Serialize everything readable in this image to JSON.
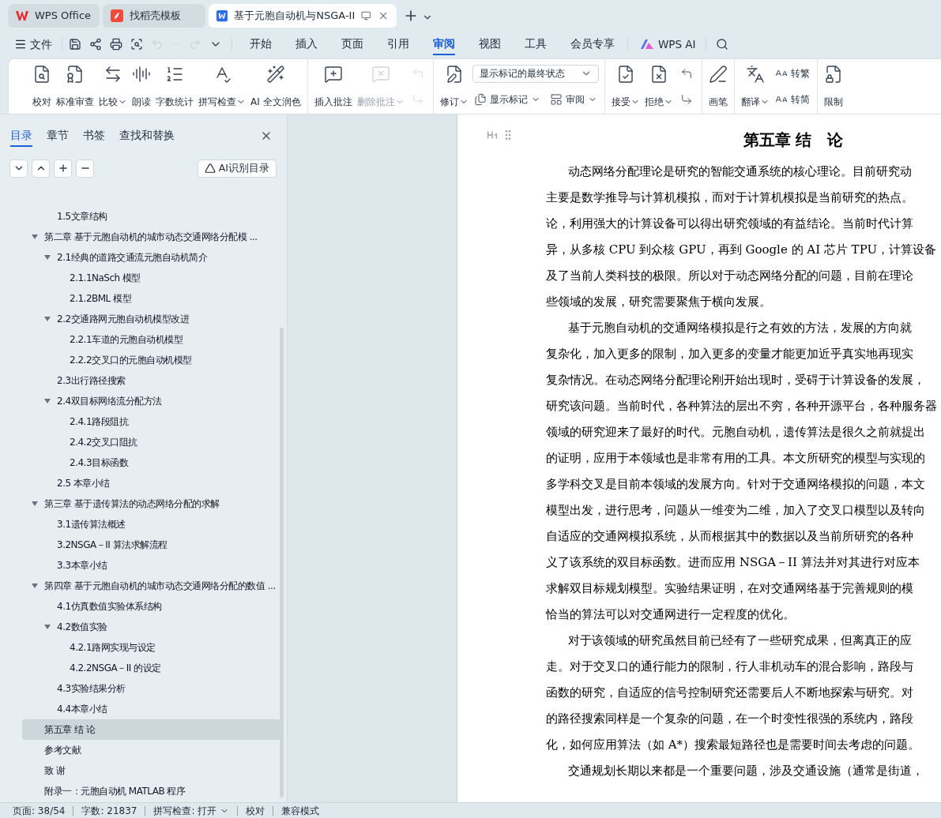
{
  "app_tabs": [
    {
      "kind": "home",
      "label": "WPS Office",
      "selected": false
    },
    {
      "kind": "template",
      "label": "找稻壳模板",
      "selected": false
    },
    {
      "kind": "document",
      "label": "基于元胞自动机与NSGA-II",
      "selected": true
    }
  ],
  "quick_toolbar": {
    "file_label": "文件",
    "undo_enabled": false,
    "redo_enabled": false
  },
  "menu_tabs": [
    {
      "label": "开始",
      "selected": false
    },
    {
      "label": "插入",
      "selected": false
    },
    {
      "label": "页面",
      "selected": false
    },
    {
      "label": "引用",
      "selected": false
    },
    {
      "label": "审阅",
      "selected": true
    },
    {
      "label": "视图",
      "selected": false
    },
    {
      "label": "工具",
      "selected": false
    },
    {
      "label": "会员专享",
      "selected": false
    }
  ],
  "wps_ai_label": "WPS AI",
  "ribbon": [
    {
      "items": [
        {
          "kind": "large",
          "label": "校对",
          "dropdown": false,
          "disabled": false
        },
        {
          "kind": "large",
          "label": "标准审查",
          "dropdown": false,
          "disabled": false
        },
        {
          "kind": "large",
          "label": "比较",
          "dropdown": true,
          "disabled": false
        },
        {
          "kind": "large",
          "label": "朗读",
          "dropdown": false,
          "disabled": false
        },
        {
          "kind": "large",
          "label": "字数统计",
          "dropdown": false,
          "disabled": false
        },
        {
          "kind": "large",
          "label": "拼写检查",
          "dropdown": true,
          "disabled": false
        },
        {
          "kind": "large",
          "label": "AI 全文润色",
          "dropdown": false,
          "disabled": false
        }
      ]
    },
    {
      "items": [
        {
          "kind": "large",
          "label": "插入批注",
          "dropdown": false,
          "disabled": false
        },
        {
          "kind": "large",
          "label": "删除批注",
          "dropdown": true,
          "disabled": true
        },
        {
          "kind": "stack",
          "rows": [
            [
              {
                "kind": "icon",
                "disabled": true
              }
            ],
            [
              {
                "kind": "icon",
                "disabled": true
              }
            ]
          ]
        }
      ]
    },
    {
      "items": [
        {
          "kind": "large",
          "label": "修订",
          "dropdown": true,
          "disabled": false
        },
        {
          "kind": "stack",
          "rows": [
            [
              {
                "kind": "select",
                "value": "显示标记的最终状态"
              }
            ],
            [
              {
                "kind": "small",
                "label": "显示标记",
                "dropdown": true,
                "disabled": false
              },
              {
                "kind": "small",
                "label": "审阅",
                "dropdown": true,
                "disabled": false
              }
            ]
          ]
        }
      ]
    },
    {
      "items": [
        {
          "kind": "large",
          "label": "接受",
          "dropdown": true,
          "disabled": false
        },
        {
          "kind": "large",
          "label": "拒绝",
          "dropdown": true,
          "disabled": false
        },
        {
          "kind": "stack",
          "rows": [
            [
              {
                "kind": "icon",
                "disabled": false
              }
            ],
            [
              {
                "kind": "icon",
                "disabled": false
              }
            ]
          ]
        }
      ]
    },
    {
      "items": [
        {
          "kind": "large",
          "label": "画笔",
          "dropdown": false,
          "disabled": false
        }
      ]
    },
    {
      "items": [
        {
          "kind": "large",
          "label": "翻译",
          "dropdown": true,
          "disabled": false
        },
        {
          "kind": "stack",
          "rows": [
            [
              {
                "kind": "small",
                "label": "转繁",
                "dropdown": false,
                "disabled": false
              }
            ],
            [
              {
                "kind": "small",
                "label": "转简",
                "dropdown": false,
                "disabled": false
              }
            ]
          ]
        }
      ]
    },
    {
      "items": [
        {
          "kind": "large",
          "label": "限制",
          "dropdown": false,
          "disabled": false
        }
      ]
    }
  ],
  "nav_panel": {
    "tabs": [
      {
        "label": "目录",
        "selected": true
      },
      {
        "label": "章节",
        "selected": false
      },
      {
        "label": "书签",
        "selected": false
      },
      {
        "label": "查找和替换",
        "selected": false
      }
    ],
    "ai_button": "AI识别目录",
    "toc": [
      {
        "children": [
          {
            "label": "1.5文章结构",
            "selected": false
          }
        ]
      },
      {
        "label": "第二章 基于元胞自动机的城市动态交通网络分配模 ...",
        "selected": false,
        "expanded": true,
        "children": [
          {
            "label": "2.1经典的道路交通流元胞自动机简介",
            "selected": false,
            "expanded": true,
            "children": [
              {
                "label": "2.1.1NaSch 模型",
                "selected": false
              },
              {
                "label": "2.1.2BML 模型",
                "selected": false
              }
            ]
          },
          {
            "label": "2.2交通路网元胞自动机模型改进",
            "selected": false,
            "expanded": true,
            "children": [
              {
                "label": "2.2.1车道的元胞自动机模型",
                "selected": false
              },
              {
                "label": "2.2.2交叉口的元胞自动机模型",
                "selected": false
              }
            ]
          },
          {
            "label": "2.3出行路径搜索",
            "selected": false
          },
          {
            "label": "2.4双目标网络流分配方法",
            "selected": false,
            "expanded": true,
            "children": [
              {
                "label": "2.4.1路段阻抗",
                "selected": false
              },
              {
                "label": "2.4.2交叉口阻抗",
                "selected": false
              },
              {
                "label": "2.4.3目标函数",
                "selected": false
              }
            ]
          },
          {
            "label": "2.5 本章小结",
            "selected": false
          }
        ]
      },
      {
        "label": "第三章 基于遗传算法的动态网络分配的求解",
        "selected": false,
        "expanded": true,
        "children": [
          {
            "label": "3.1遗传算法概述",
            "selected": false
          },
          {
            "label": "3.2NSGA－II 算法求解流程",
            "selected": false
          },
          {
            "label": "3.3本章小结",
            "selected": false
          }
        ]
      },
      {
        "label": "第四章 基于元胞自动机的城市动态交通网络分配的数值 ...",
        "selected": false,
        "expanded": true,
        "children": [
          {
            "label": "4.1仿真数值实验体系结构",
            "selected": false
          },
          {
            "label": "4.2数值实验",
            "selected": false,
            "expanded": true,
            "children": [
              {
                "label": "4.2.1路网实现与设定",
                "selected": false
              },
              {
                "label": "4.2.2NSGA－II 的设定",
                "selected": false
              }
            ]
          },
          {
            "label": "4.3实验结果分析",
            "selected": false
          },
          {
            "label": "4.4本章小结",
            "selected": false
          }
        ]
      },
      {
        "label": "第五章 结 论",
        "selected": true
      },
      {
        "label": "参考文献",
        "selected": false
      },
      {
        "label": "致 谢",
        "selected": false
      },
      {
        "label": "附录一：元胞自动机 MATLAB 程序",
        "selected": false
      }
    ]
  },
  "document": {
    "title": "第五章 结　论",
    "paragraphs": [
      [
        "动态网络分配理论是研究的智能交通系统的核心理论。目前研究动",
        "主要是数学推导与计算机模拟，而对于计算机模拟是当前研究的热点。",
        "论，利用强大的计算设备可以得出研究领域的有益结论。当前时代计算",
        "异，从多核 CPU 到众核 GPU，再到 Google 的 AI 芯片 TPU，计算设备",
        "及了当前人类科技的极限。所以对于动态网络分配的问题，目前在理论",
        "些领域的发展，研究需要聚焦于横向发展。"
      ],
      [
        "基于元胞自动机的交通网络模拟是行之有效的方法，发展的方向就",
        "复杂化，加入更多的限制，加入更多的变量才能更加近乎真实地再现实",
        "复杂情况。在动态网络分配理论刚开始出现时，受碍于计算设备的发展，",
        "研究该问题。当前时代，各种算法的层出不穷，各种开源平台，各种服务器",
        "领域的研究迎来了最好的时代。元胞自动机，遗传算法是很久之前就提出",
        "的证明，应用于本领域也是非常有用的工具。本文所研究的模型与实现的",
        "多学科交叉是目前本领域的发展方向。针对于交通网络模拟的问题，本文",
        "模型出发，进行思考，问题从一维变为二维，加入了交叉口模型以及转向",
        "自适应的交通网模拟系统，从而根据其中的数据以及当前所研究的各种",
        "义了该系统的双目标函数。进而应用 NSGA－II 算法并对其进行对应本",
        "求解双目标规划模型。实验结果证明，在对交通网络基于完善规则的模",
        "恰当的算法可以对交通网进行一定程度的优化。"
      ],
      [
        "对于该领域的研究虽然目前已经有了一些研究成果，但离真正的应",
        "走。对于交叉口的通行能力的限制，行人非机动车的混合影响，路段与",
        "函数的研究，自适应的信号控制研究还需要后人不断地探索与研究。对",
        "的路径搜索同样是一个复杂的问题，在一个时变性很强的系统内，路段",
        "化，如何应用算法（如 A*）搜索最短路径也是需要时间去考虑的问题。"
      ],
      [
        "交通规划长期以来都是一个重要问题，涉及交通设施（通常是街道，"
      ]
    ]
  },
  "status_bar": [
    {
      "kind": "text",
      "label": "页面: 38/54"
    },
    {
      "kind": "text",
      "label": "字数: 21837"
    },
    {
      "kind": "dropdown",
      "label": "拼写检查: 打开"
    },
    {
      "kind": "button",
      "label": "校对"
    },
    {
      "kind": "text",
      "label": "兼容模式"
    }
  ]
}
